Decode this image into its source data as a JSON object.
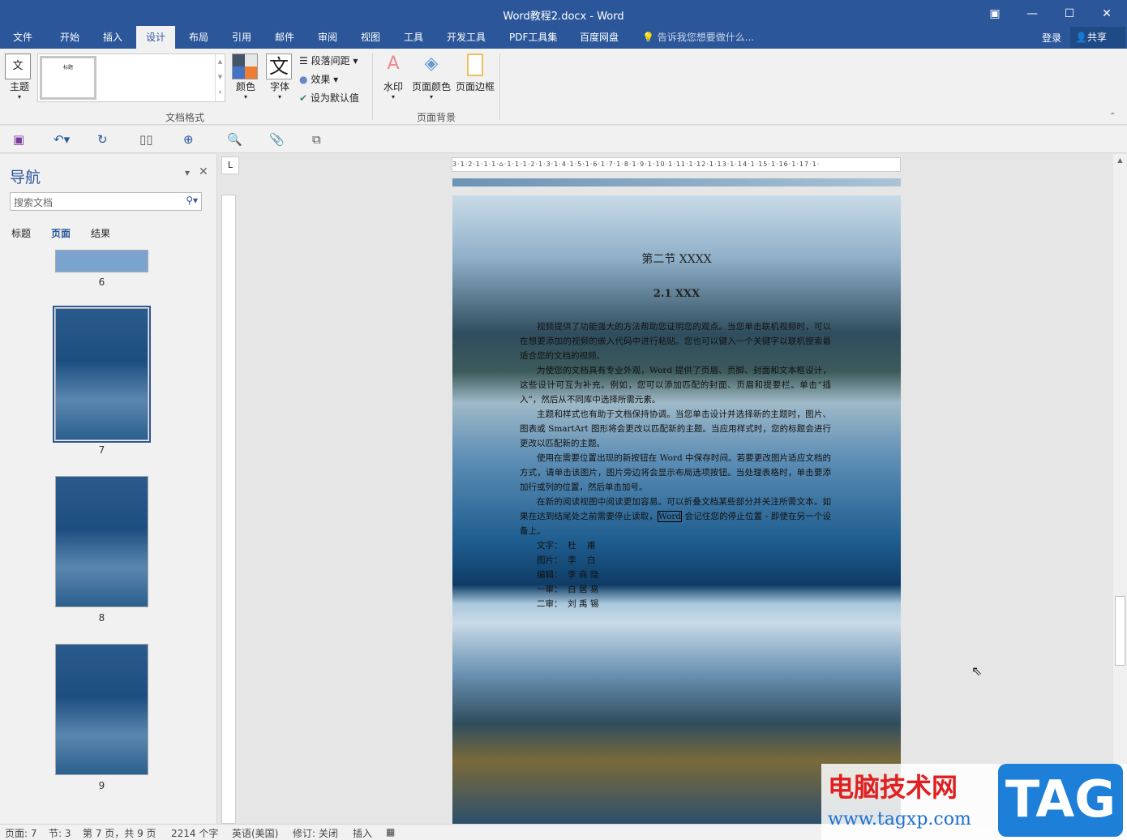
{
  "window": {
    "title": "Word教程2.docx - Word",
    "restore_icon": "▣",
    "minimize": "—",
    "maximize": "☐",
    "close": "✕"
  },
  "tabs": [
    "文件",
    "开始",
    "插入",
    "设计",
    "布局",
    "引用",
    "邮件",
    "审阅",
    "视图",
    "工具",
    "开发工具",
    "PDF工具集",
    "百度网盘"
  ],
  "tell_me": "告诉我您想要做什么...",
  "login": "登录",
  "share": "共享",
  "ribbon": {
    "theme": "主题",
    "style_preview": "标题",
    "colors": "颜色",
    "fonts": "字体",
    "para_spacing": "段落间距",
    "effects": "效果",
    "set_default": "设为默认值",
    "group_format": "文档格式",
    "watermark": "水印",
    "page_color": "页面颜色",
    "page_border": "页面边框",
    "group_bg": "页面背景",
    "theme_colors": [
      "#44546a",
      "#e7e6e6",
      "#4472c4",
      "#ed7d31"
    ]
  },
  "nav": {
    "title": "导航",
    "search_placeholder": "搜索文档",
    "tabs": [
      "标题",
      "页面",
      "结果"
    ],
    "pages": [
      "6",
      "7",
      "8",
      "9"
    ]
  },
  "ruler": {
    "h": "3·1·2·1·1·1·⌂·1·1·1·2·1·3·1·4·1·5·1·6·1·7·1·8·1·9·1·10·1·11·1·12·1·13·1·14·1·15·1·16·1·17·1·"
  },
  "doc": {
    "heading": "第二节 XXXX",
    "subheading": "2.1 XXX",
    "paragraphs": [
      "视频提供了功能强大的方法帮助您证明您的观点。当您单击联机视频时，可以在想要添加的视频的嵌入代码中进行粘贴。您也可以键入一个关键字以联机搜索最适合您的文档的视频。",
      "为使您的文档具有专业外观，Word 提供了页眉、页脚、封面和文本框设计，这些设计可互为补充。例如，您可以添加匹配的封面、页眉和提要栏。单击“插入”，然后从不同库中选择所需元素。",
      "主题和样式也有助于文档保持协调。当您单击设计并选择新的主题时，图片、图表或 SmartArt 图形将会更改以匹配新的主题。当应用样式时，您的标题会进行更改以匹配新的主题。",
      "使用在需要位置出现的新按钮在 Word 中保存时间。若要更改图片适应文档的方式，请单击该图片，图片旁边将会显示布局选项按钮。当处理表格时，单击要添加行或列的位置，然后单击加号。"
    ],
    "p5_a": "在新的阅读视图中阅读更加容易。可以折叠文档某些部分并关注所需文本。如果在达到结尾处之前需要停止读取，",
    "p5_word": "Word",
    "p5_b": " 会记住您的停止位置 - 即使在另一个设备上。",
    "credits": [
      "文字：  杜    甫",
      "图片：  李    白",
      "编辑：  李 商 隐",
      "一审：  白 居 易",
      "二审：  刘 禹 锡"
    ]
  },
  "status": {
    "page": "页面: 7",
    "section": "节: 3",
    "pages": "第 7 页，共 9 页",
    "words": "2214 个字",
    "lang": "英语(美国)",
    "track": "修订: 关闭",
    "mode": "插入"
  },
  "watermark": {
    "site": "电脑技术网",
    "url": "www.tagxp.com",
    "tag": "TAG"
  }
}
